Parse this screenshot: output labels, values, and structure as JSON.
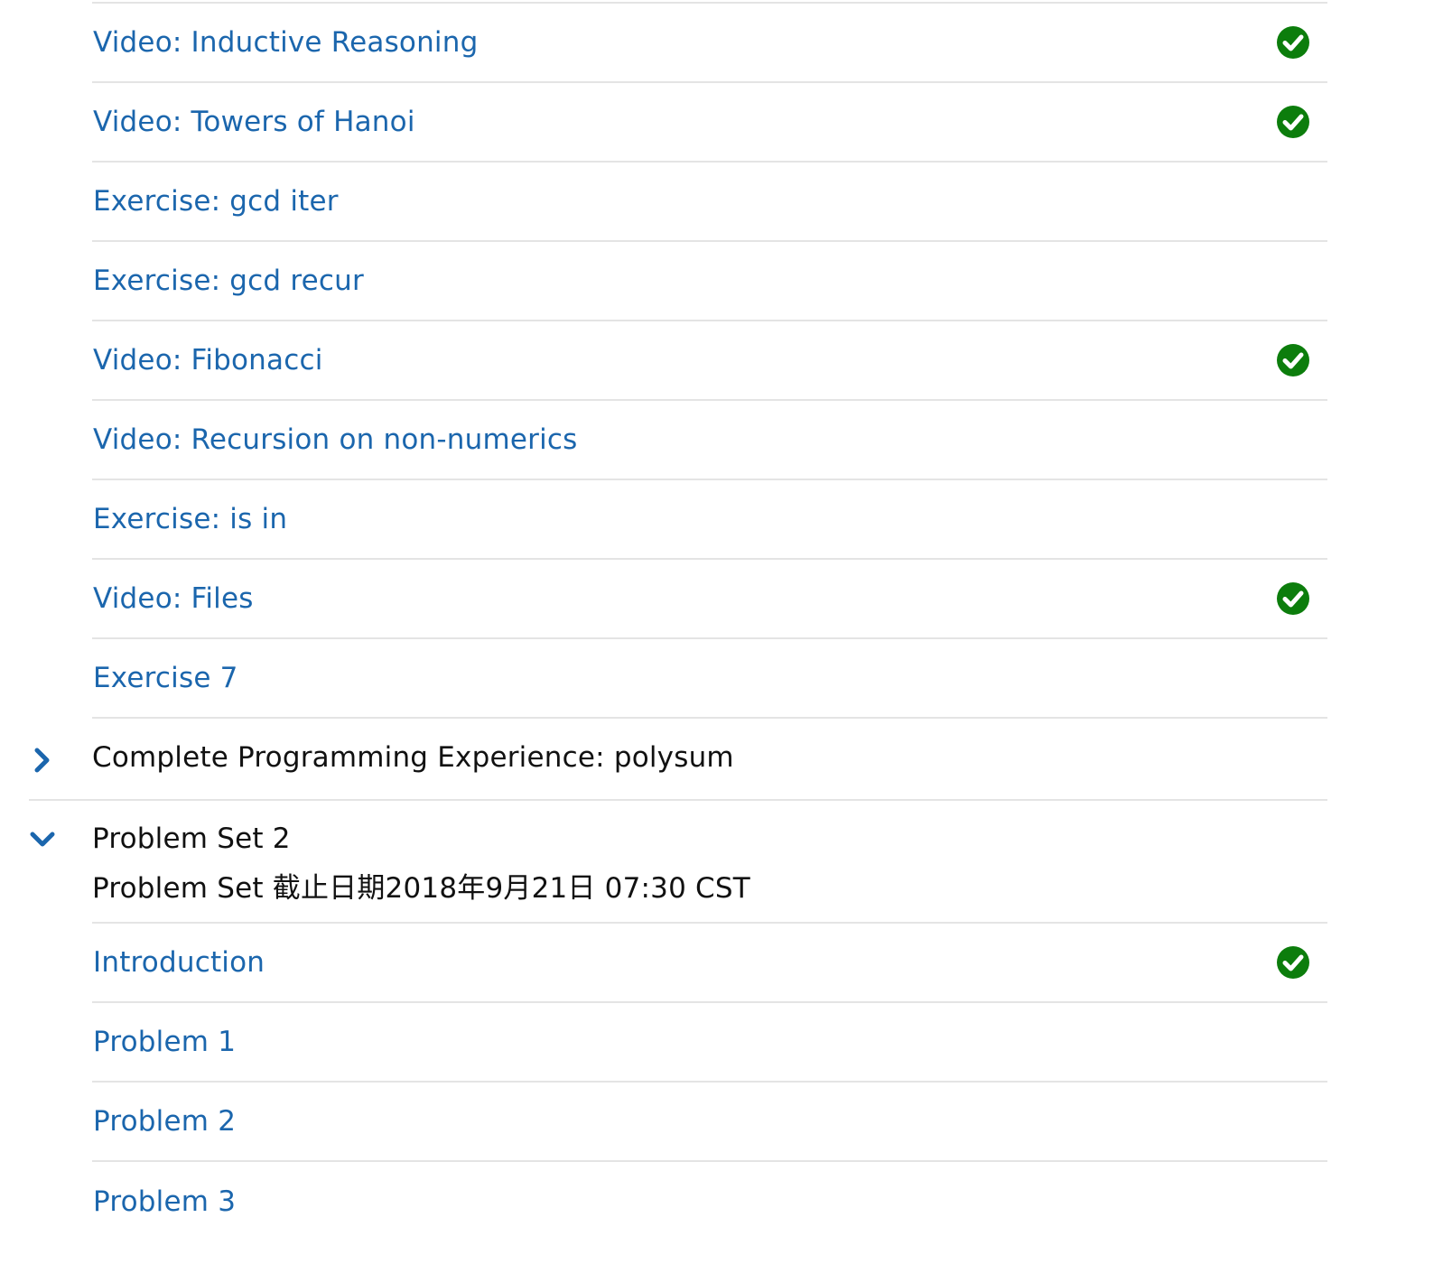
{
  "outline": {
    "items_a": [
      {
        "label": "Video: Inductive Reasoning",
        "completed": true
      },
      {
        "label": "Video: Towers of Hanoi",
        "completed": true
      },
      {
        "label": "Exercise: gcd iter",
        "completed": false
      },
      {
        "label": "Exercise: gcd recur",
        "completed": false
      },
      {
        "label": "Video: Fibonacci",
        "completed": true
      },
      {
        "label": "Video: Recursion on non-numerics",
        "completed": false
      },
      {
        "label": "Exercise: is in",
        "completed": false
      },
      {
        "label": "Video: Files",
        "completed": true
      },
      {
        "label": "Exercise 7",
        "completed": false
      }
    ],
    "section_collapsed": {
      "title": "Complete Programming Experience: polysum",
      "icon": "chevron-right-icon"
    },
    "section_expanded": {
      "title": "Problem Set 2",
      "due": "Problem Set 截止日期2018年9月21日 07:30 CST",
      "icon": "chevron-down-icon"
    },
    "items_b": [
      {
        "label": "Introduction",
        "completed": true
      },
      {
        "label": "Problem 1",
        "completed": false
      },
      {
        "label": "Problem 2",
        "completed": false
      },
      {
        "label": "Problem 3",
        "completed": false
      }
    ]
  },
  "colors": {
    "link": "#1b66ad",
    "check": "#0c7d0c",
    "divider": "#e4e4e4",
    "text": "#111111"
  }
}
